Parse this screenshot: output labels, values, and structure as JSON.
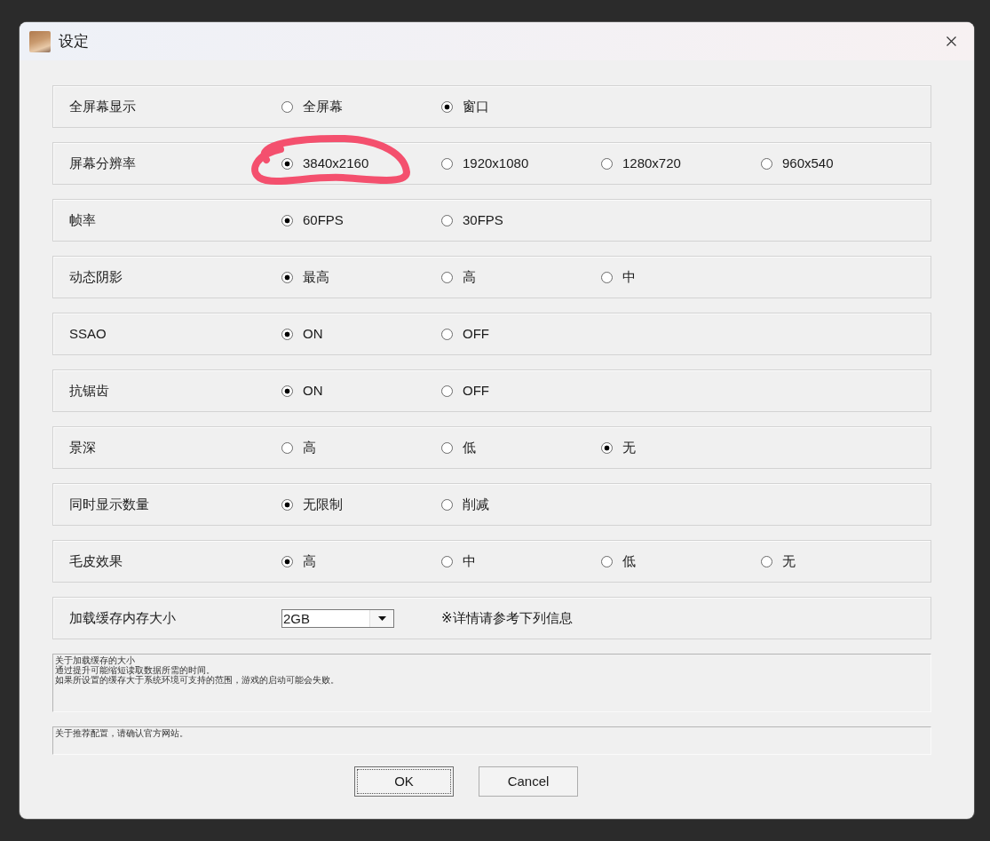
{
  "window": {
    "title": "设定"
  },
  "settings": [
    {
      "label": "全屏幕显示",
      "kind": "radio",
      "options": [
        {
          "label": "全屏幕",
          "selected": false,
          "circled": false
        },
        {
          "label": "窗口",
          "selected": true,
          "circled": false
        }
      ]
    },
    {
      "label": "屏幕分辨率",
      "kind": "radio",
      "options": [
        {
          "label": "3840x2160",
          "selected": true,
          "circled": true
        },
        {
          "label": "1920x1080",
          "selected": false,
          "circled": false
        },
        {
          "label": "1280x720",
          "selected": false,
          "circled": false
        },
        {
          "label": "960x540",
          "selected": false,
          "circled": false
        }
      ]
    },
    {
      "label": "帧率",
      "kind": "radio",
      "options": [
        {
          "label": "60FPS",
          "selected": true,
          "circled": false
        },
        {
          "label": "30FPS",
          "selected": false,
          "circled": false
        }
      ]
    },
    {
      "label": "动态阴影",
      "kind": "radio",
      "options": [
        {
          "label": "最高",
          "selected": true,
          "circled": false
        },
        {
          "label": "高",
          "selected": false,
          "circled": false
        },
        {
          "label": "中",
          "selected": false,
          "circled": false
        }
      ]
    },
    {
      "label": "SSAO",
      "kind": "radio",
      "options": [
        {
          "label": "ON",
          "selected": true,
          "circled": false
        },
        {
          "label": "OFF",
          "selected": false,
          "circled": false
        }
      ]
    },
    {
      "label": "抗锯齿",
      "kind": "radio",
      "options": [
        {
          "label": "ON",
          "selected": true,
          "circled": false
        },
        {
          "label": "OFF",
          "selected": false,
          "circled": false
        }
      ]
    },
    {
      "label": "景深",
      "kind": "radio",
      "options": [
        {
          "label": "高",
          "selected": false,
          "circled": false
        },
        {
          "label": "低",
          "selected": false,
          "circled": false
        },
        {
          "label": "无",
          "selected": true,
          "circled": false
        }
      ]
    },
    {
      "label": "同时显示数量",
      "kind": "radio",
      "options": [
        {
          "label": "无限制",
          "selected": true,
          "circled": false
        },
        {
          "label": "削减",
          "selected": false,
          "circled": false
        }
      ]
    },
    {
      "label": "毛皮效果",
      "kind": "radio",
      "options": [
        {
          "label": "高",
          "selected": true,
          "circled": false
        },
        {
          "label": "中",
          "selected": false,
          "circled": false
        },
        {
          "label": "低",
          "selected": false,
          "circled": false
        },
        {
          "label": "无",
          "selected": false,
          "circled": false
        }
      ]
    },
    {
      "label": "加载缓存内存大小",
      "kind": "dropdown",
      "value": "2GB",
      "note": "※详情请参考下列信息"
    }
  ],
  "info_boxes": [
    {
      "lines": [
        "关于加载缓存的大小",
        "通过提升可能缩短读取数据所需的时间。",
        "如果所设置的缓存大于系统环境可支持的范围，游戏的启动可能会失败。"
      ]
    },
    {
      "lines": [
        "关于推荐配置，请确认官方网站。"
      ]
    }
  ],
  "buttons": [
    {
      "label": "OK",
      "focused": true
    },
    {
      "label": "Cancel",
      "focused": false
    }
  ]
}
